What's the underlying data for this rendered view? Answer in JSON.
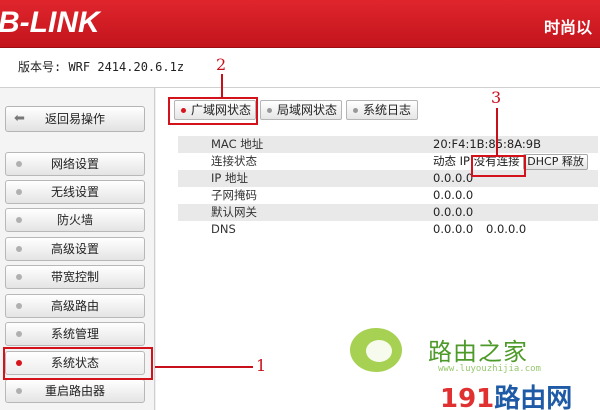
{
  "header": {
    "logo_text": "B-LINK",
    "slogan": "时尚以"
  },
  "version": {
    "label": "版本号: WRF 2414.20.6.1z"
  },
  "sidebar": {
    "back_label": "返回易操作",
    "items": [
      {
        "label": "网络设置"
      },
      {
        "label": "无线设置"
      },
      {
        "label": "防火墙"
      },
      {
        "label": "高级设置"
      },
      {
        "label": "带宽控制"
      },
      {
        "label": "高级路由"
      },
      {
        "label": "系统管理"
      },
      {
        "label": "系统状态",
        "active": true
      },
      {
        "label": "重启路由器"
      }
    ]
  },
  "tabs": [
    {
      "label": "广域网状态",
      "active": true
    },
    {
      "label": "局域网状态"
    },
    {
      "label": "系统日志"
    }
  ],
  "wan_status": {
    "rows": [
      {
        "key": "MAC 地址",
        "value": "20:F4:1B:85:8A:9B"
      },
      {
        "key": "连接状态",
        "value_prefix": "动态 IP",
        "value_status": "没有连接",
        "button_label": "DHCP 释放"
      },
      {
        "key": "IP 地址",
        "value": "0.0.0.0"
      },
      {
        "key": "子网掩码",
        "value": "0.0.0.0"
      },
      {
        "key": "默认网关",
        "value": "0.0.0.0"
      },
      {
        "key": "DNS",
        "value": "0.0.0.0",
        "value2": "0.0.0.0"
      }
    ]
  },
  "annotations": {
    "one": "1",
    "two": "2",
    "three": "3"
  },
  "watermark": {
    "cn": "路由之家",
    "url": "www.luyouzhijia.com",
    "bottom_num": "191",
    "bottom_cn": "路由网"
  },
  "colors": {
    "brand_red": "#d9141c",
    "annotation_red": "#d4121c",
    "watermark_green": "#4d9a2a",
    "watermark_blue": "#1e5aa5"
  }
}
